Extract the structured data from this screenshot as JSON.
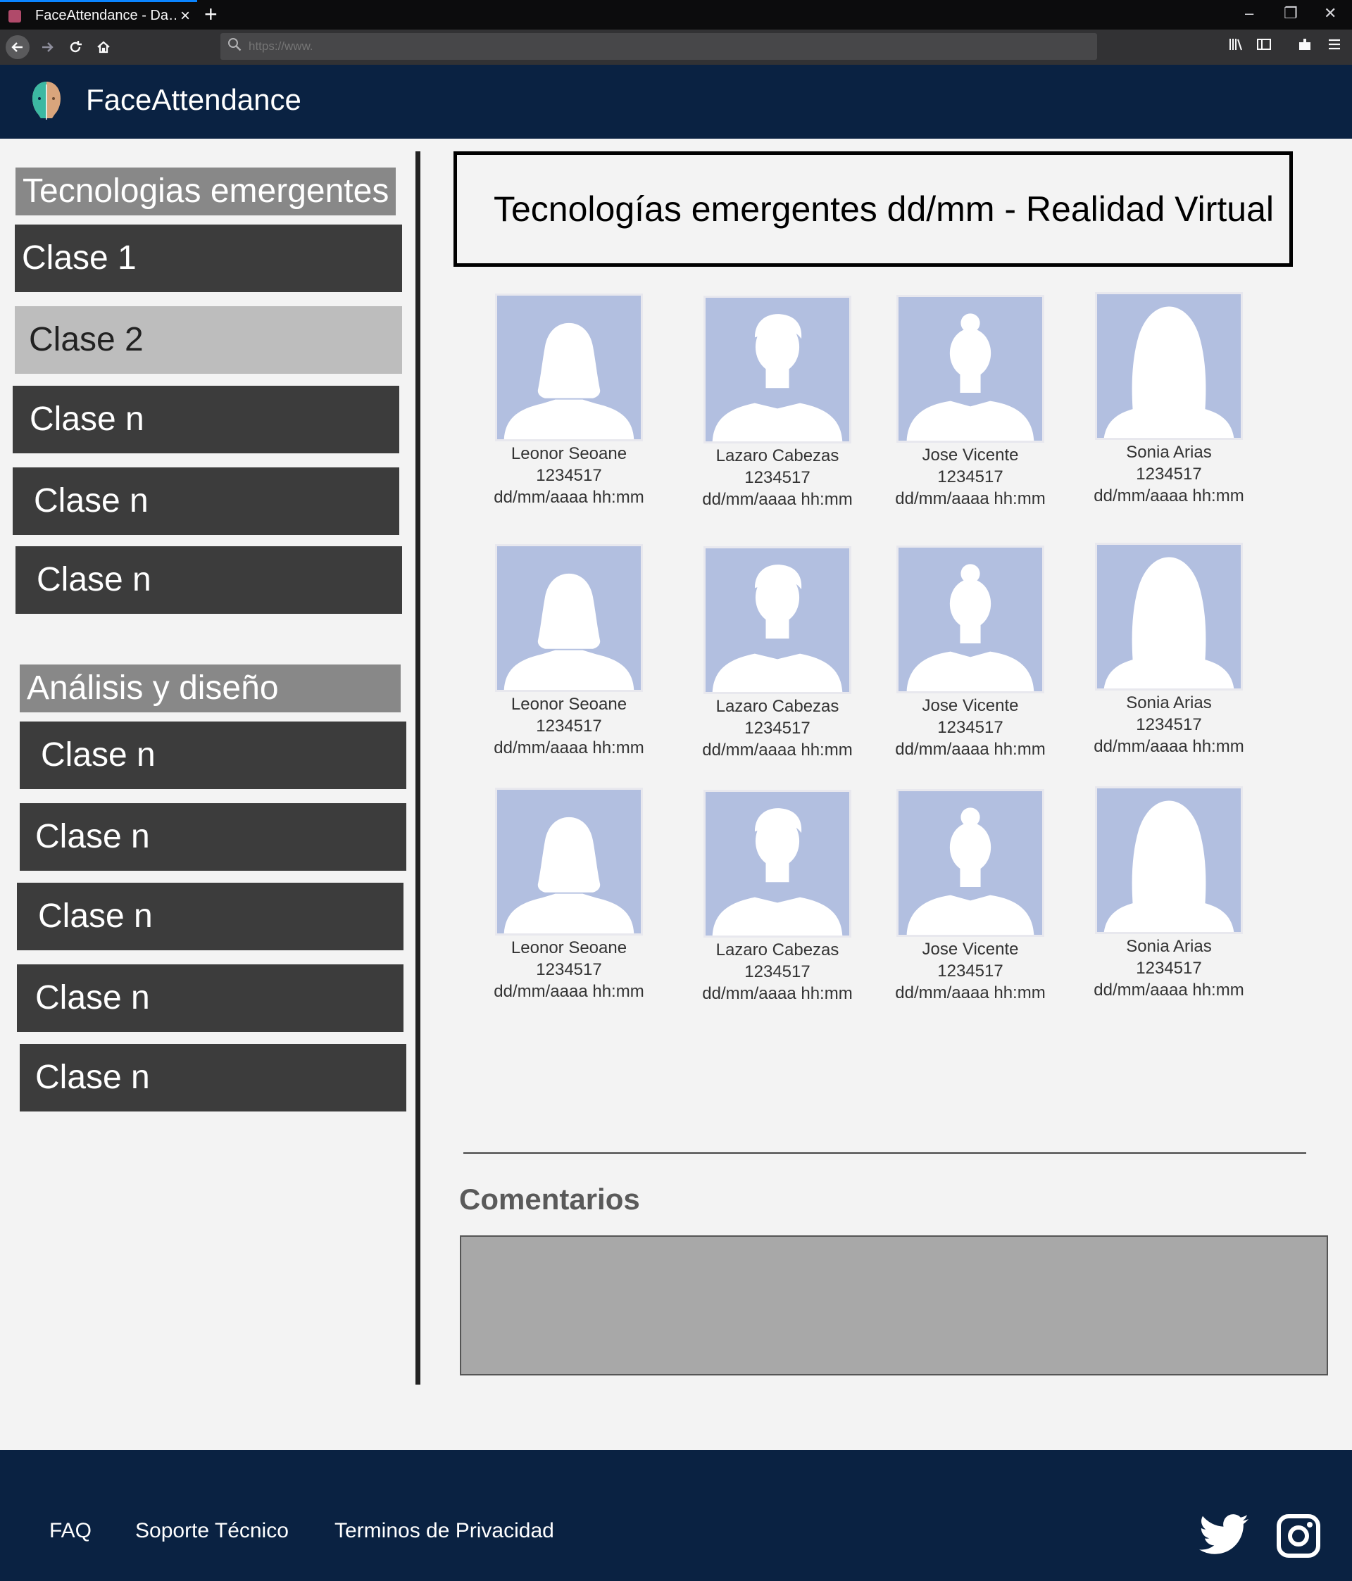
{
  "browser": {
    "tab_title": "FaceAttendance - Da…",
    "tab_close": "×",
    "new_tab": "+",
    "url_placeholder": "https://www.",
    "window_controls": [
      "–",
      "❐",
      "✕"
    ]
  },
  "app": {
    "brand": "FaceAttendance",
    "brand_colors": {
      "header": "#0a2242",
      "sidebar_item": "#3c3c3c",
      "sidebar_active": "#bdbdbd",
      "section_head": "#888888"
    }
  },
  "sidebar": {
    "section1": {
      "title": "Tecnologias emergentes",
      "items": [
        {
          "label": "Clase 1"
        },
        {
          "label": "Clase 2",
          "active": true
        },
        {
          "label": "Clase n"
        },
        {
          "label": "Clase n"
        },
        {
          "label": "Clase n"
        }
      ]
    },
    "section2": {
      "title": "Análisis y diseño",
      "items": [
        {
          "label": "Clase n"
        },
        {
          "label": "Clase n"
        },
        {
          "label": "Clase n"
        },
        {
          "label": "Clase n"
        },
        {
          "label": "Clase n"
        }
      ]
    }
  },
  "main": {
    "title": "Tecnologías emergentes dd/mm - Realidad Virtual",
    "students": [
      {
        "name": "Leonor Seoane",
        "id": "1234517",
        "timestamp": "dd/mm/aaaa hh:mm",
        "avatar": "female-short-hair-avatar"
      },
      {
        "name": "Lazaro Cabezas",
        "id": "1234517",
        "timestamp": "dd/mm/aaaa hh:mm",
        "avatar": "male-avatar"
      },
      {
        "name": "Jose Vicente",
        "id": "1234517",
        "timestamp": "dd/mm/aaaa hh:mm",
        "avatar": "bun-hair-avatar"
      },
      {
        "name": "Sonia Arias",
        "id": "1234517",
        "timestamp": "dd/mm/aaaa hh:mm",
        "avatar": "female-long-hair-avatar"
      },
      {
        "name": "Leonor Seoane",
        "id": "1234517",
        "timestamp": "dd/mm/aaaa hh:mm",
        "avatar": "female-short-hair-avatar"
      },
      {
        "name": "Lazaro Cabezas",
        "id": "1234517",
        "timestamp": "dd/mm/aaaa hh:mm",
        "avatar": "male-avatar"
      },
      {
        "name": "Jose Vicente",
        "id": "1234517",
        "timestamp": "dd/mm/aaaa hh:mm",
        "avatar": "bun-hair-avatar"
      },
      {
        "name": "Sonia Arias",
        "id": "1234517",
        "timestamp": "dd/mm/aaaa hh:mm",
        "avatar": "female-long-hair-avatar"
      },
      {
        "name": "Leonor Seoane",
        "id": "1234517",
        "timestamp": "dd/mm/aaaa hh:mm",
        "avatar": "female-short-hair-avatar"
      },
      {
        "name": "Lazaro Cabezas",
        "id": "1234517",
        "timestamp": "dd/mm/aaaa hh:mm",
        "avatar": "male-avatar"
      },
      {
        "name": "Jose Vicente",
        "id": "1234517",
        "timestamp": "dd/mm/aaaa hh:mm",
        "avatar": "bun-hair-avatar"
      },
      {
        "name": "Sonia Arias",
        "id": "1234517",
        "timestamp": "dd/mm/aaaa hh:mm",
        "avatar": "female-long-hair-avatar"
      }
    ],
    "comments_label": "Comentarios",
    "comments_value": ""
  },
  "footer": {
    "links": {
      "faq": "FAQ",
      "support": "Soporte Técnico",
      "privacy": "Terminos de Privacidad"
    },
    "social": [
      "twitter-icon",
      "instagram-icon"
    ]
  }
}
